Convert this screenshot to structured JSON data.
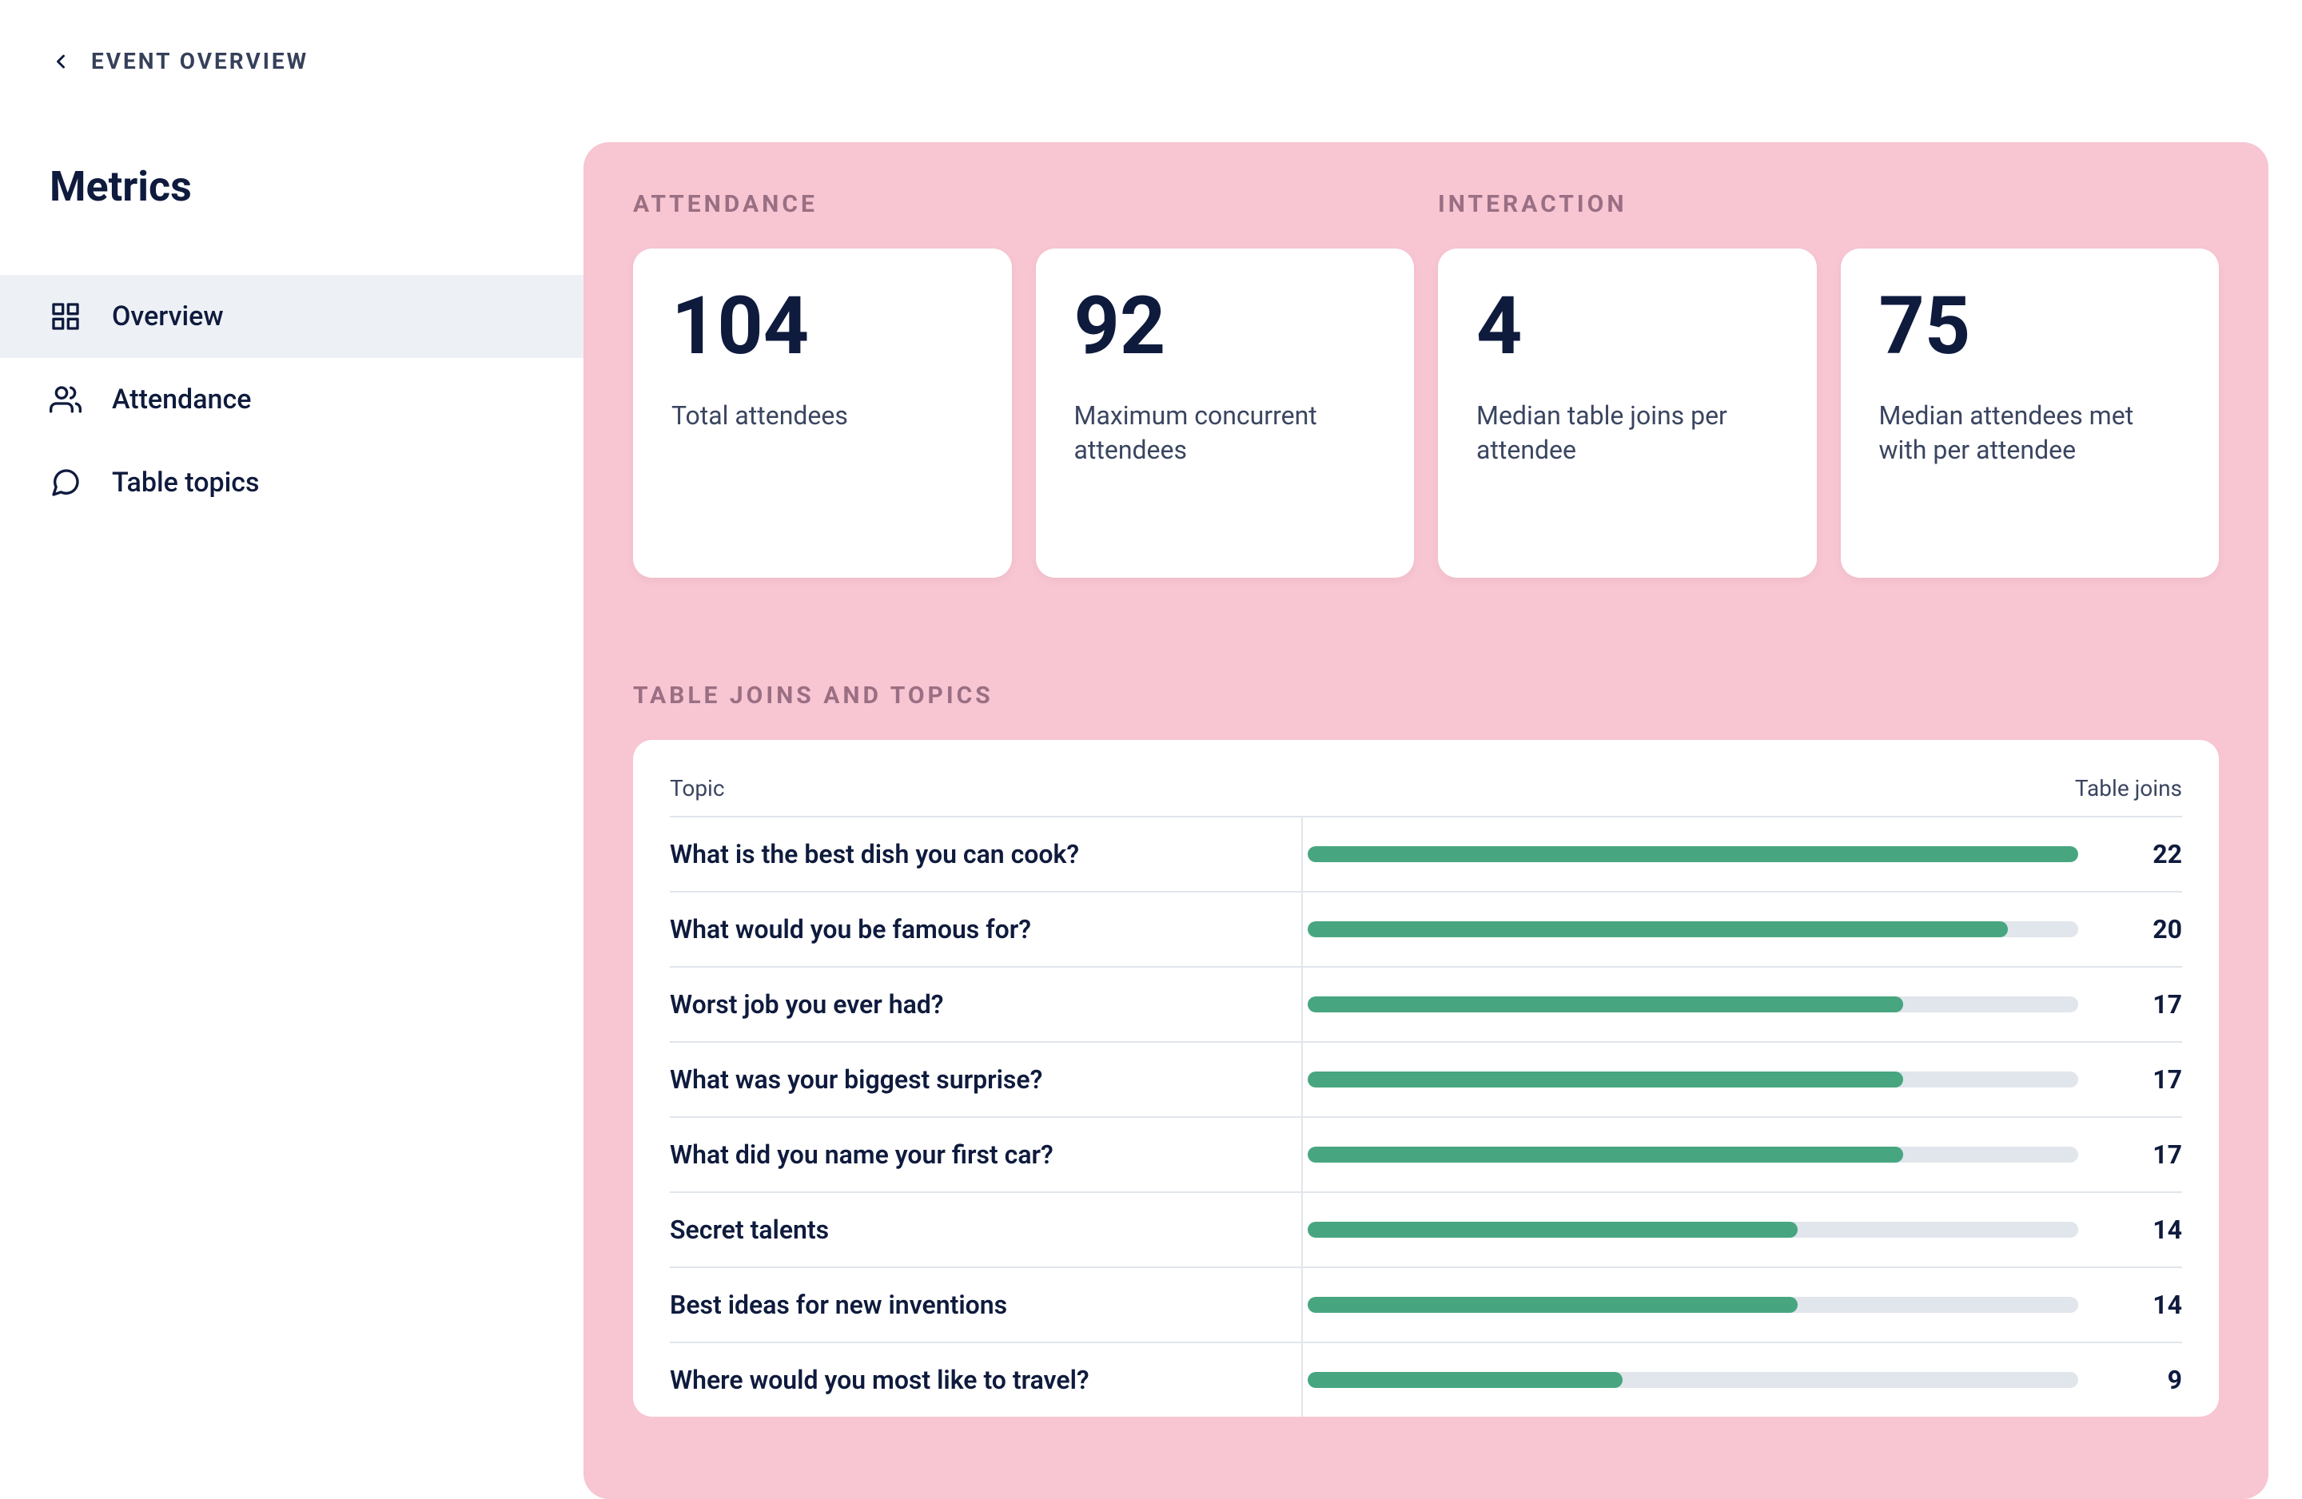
{
  "back": {
    "label": "EVENT OVERVIEW"
  },
  "page_title": "Metrics",
  "nav": {
    "overview": "Overview",
    "attendance": "Attendance",
    "table_topics": "Table topics"
  },
  "sections": {
    "attendance_heading": "ATTENDANCE",
    "interaction_heading": "INTERACTION",
    "topics_heading": "TABLE JOINS AND TOPICS"
  },
  "cards": {
    "total_attendees": {
      "value": "104",
      "label": "Total attendees"
    },
    "max_concurrent": {
      "value": "92",
      "label": "Maximum concurrent attendees"
    },
    "median_joins": {
      "value": "4",
      "label": "Median table joins per attendee"
    },
    "median_met": {
      "value": "75",
      "label": "Median attendees met with per attendee"
    }
  },
  "topics_table": {
    "col_topic": "Topic",
    "col_joins": "Table joins"
  },
  "chart_data": {
    "type": "bar",
    "title": "Table joins and topics",
    "xlabel": "Table joins",
    "ylabel": "Topic",
    "max": 22,
    "series": [
      {
        "name": "What is the best dish you can cook?",
        "value": 22
      },
      {
        "name": "What would you be famous for?",
        "value": 20
      },
      {
        "name": "Worst job you ever had?",
        "value": 17
      },
      {
        "name": "What was your biggest surprise?",
        "value": 17
      },
      {
        "name": "What did you name your first car?",
        "value": 17
      },
      {
        "name": "Secret talents",
        "value": 14
      },
      {
        "name": "Best ideas for new inventions",
        "value": 14
      },
      {
        "name": "Where would you most like to travel?",
        "value": 9
      }
    ]
  }
}
